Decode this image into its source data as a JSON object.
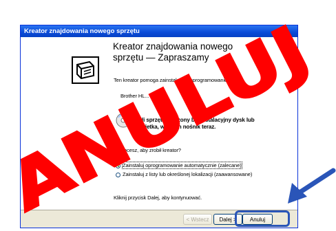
{
  "window": {
    "title": "Kreator znajdowania nowego sprzętu",
    "heading": "Kreator znajdowania nowego sprzętu — Zapraszamy",
    "intro": "Ten kreator pomoga zainstalować oprogramowanie",
    "device": "Brother HL... series",
    "cd_notice": "Jeśli sprzęt dołączony był instalacyjny dysk lub dyskietka, włóż ten nośnik teraz.",
    "question": "Co chcesz, aby zrobił kreator?",
    "options": [
      {
        "label": "Zainstaluj oprogramowanie automatycznie (zalecane)",
        "selected": true
      },
      {
        "label": "Zainstaluj z listy lub określonej lokalizacji (zaawansowane)",
        "selected": false
      }
    ],
    "footer_hint": "Kliknij przycisk Dalej, aby kontynuować.",
    "buttons": {
      "back": "< Wstecz",
      "next": "Dalej >",
      "cancel": "Anuluj"
    }
  },
  "overlay": {
    "stamp_text": "ANULUJ",
    "stamp_color": "#ff0000",
    "arrow_color": "#2a55b8"
  }
}
